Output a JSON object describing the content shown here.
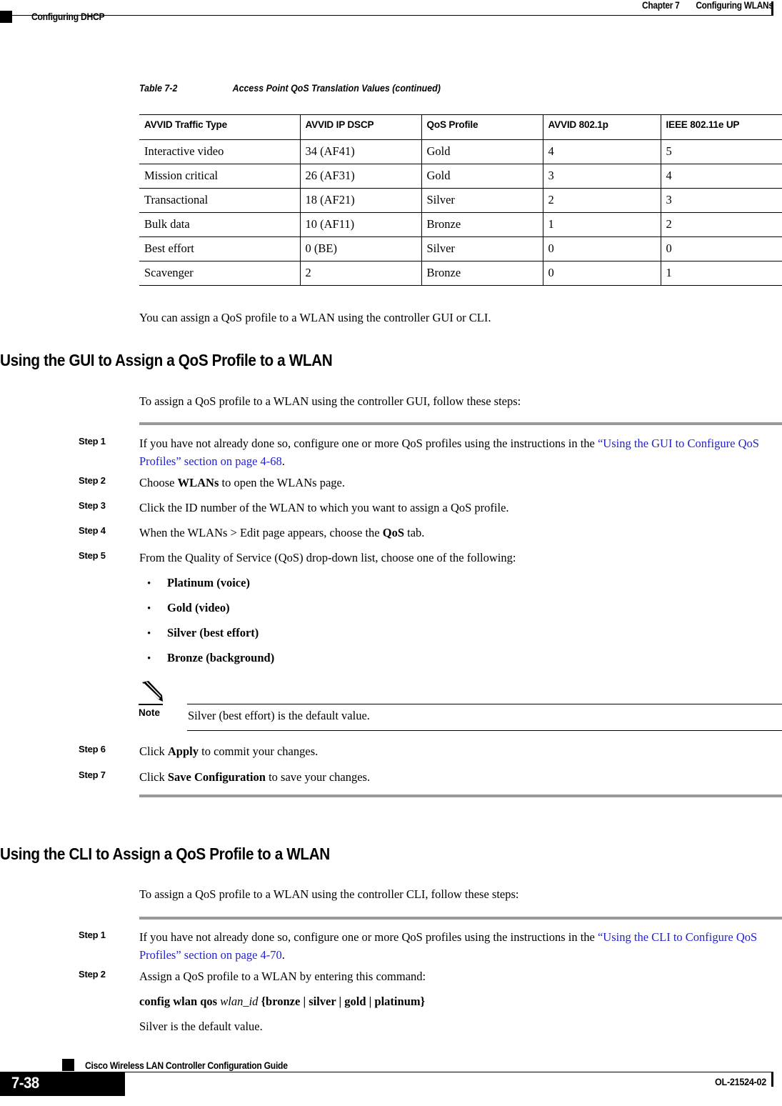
{
  "header": {
    "chapter": "Chapter 7",
    "chapter_title": "Configuring WLANs",
    "running_section": "Configuring DHCP"
  },
  "table": {
    "caption_number": "Table 7-2",
    "caption_title": "Access Point QoS Translation Values (continued)",
    "columns": [
      "AVVID Traffic Type",
      "AVVID IP DSCP",
      "QoS Profile",
      "AVVID 802.1p",
      "IEEE 802.11e UP"
    ],
    "rows": [
      [
        "Interactive video",
        "34 (AF41)",
        "Gold",
        "4",
        "5"
      ],
      [
        "Mission critical",
        "26 (AF31)",
        "Gold",
        "3",
        "4"
      ],
      [
        "Transactional",
        "18 (AF21)",
        "Silver",
        "2",
        "3"
      ],
      [
        "Bulk data",
        "10 (AF11)",
        "Bronze",
        "1",
        "2"
      ],
      [
        "Best effort",
        "0 (BE)",
        "Silver",
        "0",
        "0"
      ],
      [
        "Scavenger",
        "2",
        "Bronze",
        "0",
        "1"
      ]
    ]
  },
  "intro_paragraph": "You can assign a QoS profile to a WLAN using the controller GUI or CLI.",
  "gui_section": {
    "heading": "Using the GUI to Assign a QoS Profile to a WLAN",
    "lead_in": "To assign a QoS profile to a WLAN using the controller GUI, follow these steps:",
    "steps": [
      {
        "label": "Step 1"
      },
      {
        "label": "Step 2"
      },
      {
        "label": "Step 3"
      },
      {
        "label": "Step 4"
      },
      {
        "label": "Step 5"
      },
      {
        "label": "Step 6"
      },
      {
        "label": "Step 7"
      }
    ],
    "step1": {
      "pre": "If you have not already done so, configure one or more QoS profiles using the instructions in the ",
      "xref": "“Using the GUI to Configure QoS Profiles” section on page 4-68",
      "post": "."
    },
    "step2": {
      "pre": "Choose ",
      "bold": "WLANs",
      "post": " to open the WLANs page."
    },
    "step3": {
      "text": "Click the ID number of the WLAN to which you want to assign a QoS profile."
    },
    "step4": {
      "pre": "When the WLANs > Edit page appears, choose the ",
      "bold": "QoS",
      "post": " tab."
    },
    "step5": {
      "text": "From the Quality of Service (QoS) drop-down list, choose one of the following:"
    },
    "step6": {
      "pre": "Click ",
      "bold": "Apply",
      "post": " to commit your changes."
    },
    "step7": {
      "pre": "Click ",
      "bold": "Save Configuration",
      "post": " to save your changes."
    },
    "bullets": [
      {
        "name": "Platinum",
        "desc": "(voice)"
      },
      {
        "name": "Gold",
        "desc": "(video)"
      },
      {
        "name": "Silver",
        "desc": "(best effort)"
      },
      {
        "name": "Bronze",
        "desc": "(background)"
      }
    ],
    "note": {
      "label": "Note",
      "text": "Silver (best effort) is the default value."
    }
  },
  "cli_section": {
    "heading": "Using the CLI to Assign a QoS Profile to a WLAN",
    "lead_in": "To assign a QoS profile to a WLAN using the controller CLI, follow these steps:",
    "steps": [
      {
        "label": "Step 1"
      },
      {
        "label": "Step 2"
      }
    ],
    "step1": {
      "pre": "If you have not already done so, configure one or more QoS profiles using the instructions in the ",
      "xref": "“Using the CLI to Configure QoS Profiles” section on page 4-70",
      "post": "."
    },
    "step2": {
      "text": "Assign a QoS profile to a WLAN by entering this command:",
      "command_bold_1": "config wlan qos ",
      "command_italic": "wlan_id",
      "command_bold_2": " {bronze | silver | gold | platinum}",
      "trailing": "Silver is the default value."
    }
  },
  "footer": {
    "guide_title": "Cisco Wireless LAN Controller Configuration Guide",
    "page_number": "7-38",
    "doc_id": "OL-21524-02"
  },
  "colors": {
    "xref_blue": "#2222cc",
    "rule_gray": "#999999",
    "black": "#000000"
  }
}
